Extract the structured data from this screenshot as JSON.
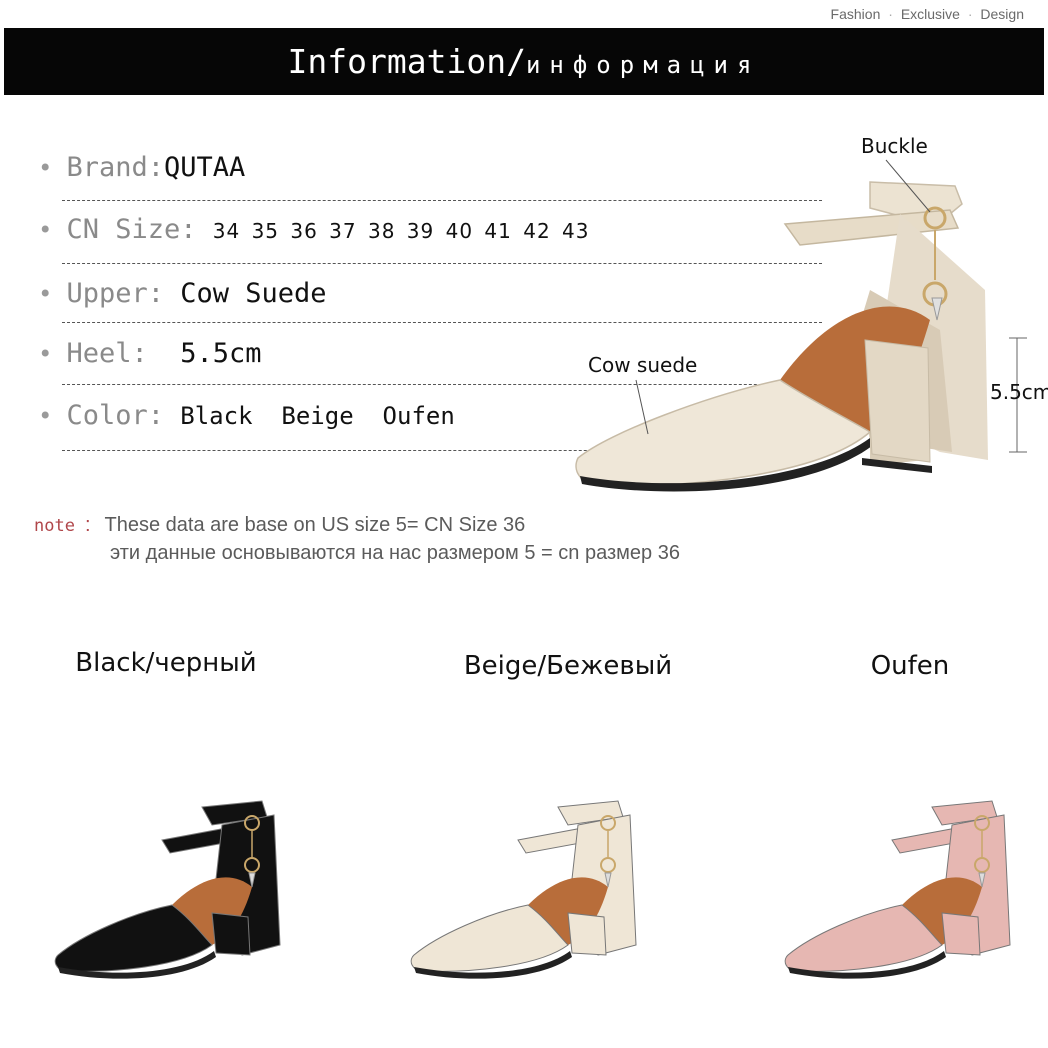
{
  "tagline": [
    "Fashion",
    "Exclusive",
    "Design"
  ],
  "header": {
    "title_en": "Information/",
    "title_ru": "информация"
  },
  "specs": {
    "brand": {
      "label": "Brand:",
      "value": "QUTAA"
    },
    "size": {
      "label": "CN Size:",
      "value": "34 35 36 37 38 39 40 41 42 43"
    },
    "upper": {
      "label": "Upper:",
      "value": "Cow Suede"
    },
    "heel": {
      "label": "Heel:",
      "value": "5.5cm"
    },
    "color": {
      "label": "Color:",
      "value": "Black  Beige  Oufen"
    }
  },
  "callouts": {
    "buckle": "Buckle",
    "material": "Cow suede",
    "heel_height": "5.5cm"
  },
  "note": {
    "label": "note",
    "line1": "These data are base on US size 5= CN Size 36",
    "line2": "эти данные основываются на нас размером 5 = cn размер 36"
  },
  "variants": [
    {
      "label": "Black/черный",
      "color": "#111111"
    },
    {
      "label": "Beige/Бежевый",
      "color": "#efe6d6"
    },
    {
      "label": "Oufen",
      "color": "#e6b7b2"
    }
  ]
}
